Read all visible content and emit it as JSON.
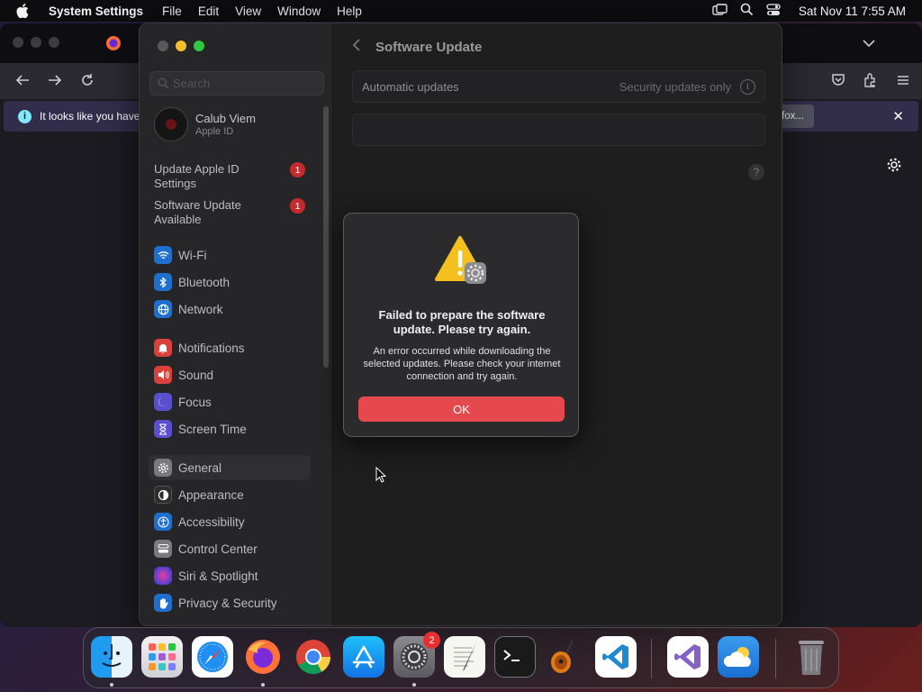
{
  "menubar": {
    "app_name": "System Settings",
    "menus": [
      "File",
      "Edit",
      "View",
      "Window",
      "Help"
    ],
    "clock": "Sat Nov 11  7:55 AM"
  },
  "firefox": {
    "notice_text": "It looks like you have",
    "notice_button": "fox..."
  },
  "settings": {
    "search_placeholder": "Search",
    "profile": {
      "name": "Calub Viem",
      "subtitle": "Apple ID"
    },
    "alerts": [
      {
        "label": "Update Apple ID Settings",
        "badge": "1"
      },
      {
        "label": "Software Update Available",
        "badge": "1"
      }
    ],
    "nav_items": [
      {
        "label": "Wi-Fi",
        "icon": "wifi-icon",
        "color": "#1f6fd1"
      },
      {
        "label": "Bluetooth",
        "icon": "bluetooth-icon",
        "color": "#1f6fd1"
      },
      {
        "label": "Network",
        "icon": "globe-icon",
        "color": "#1f6fd1"
      },
      {
        "label": "Notifications",
        "icon": "bell-icon",
        "color": "#d9413a"
      },
      {
        "label": "Sound",
        "icon": "speaker-icon",
        "color": "#d9413a"
      },
      {
        "label": "Focus",
        "icon": "moon-icon",
        "color": "#5a4fcf"
      },
      {
        "label": "Screen Time",
        "icon": "hourglass-icon",
        "color": "#5a4fcf"
      },
      {
        "label": "General",
        "icon": "gear-icon",
        "color": "#7a7a7e"
      },
      {
        "label": "Appearance",
        "icon": "appearance-icon",
        "color": "#2d2d2d"
      },
      {
        "label": "Accessibility",
        "icon": "accessibility-icon",
        "color": "#1f6fd1"
      },
      {
        "label": "Control Center",
        "icon": "control-center-icon",
        "color": "#7a7a7e"
      },
      {
        "label": "Siri & Spotlight",
        "icon": "siri-icon",
        "color": "#8a3fc7"
      },
      {
        "label": "Privacy & Security",
        "icon": "hand-icon",
        "color": "#1f6fd1"
      }
    ],
    "selected_item": "General",
    "main": {
      "title": "Software Update",
      "automatic_updates_label": "Automatic updates",
      "automatic_updates_value": "Security updates only",
      "help": "?"
    }
  },
  "dialog": {
    "title": "Failed to prepare the software update. Please try again.",
    "message": "An error occurred while downloading the selected updates. Please check your internet connection and try again.",
    "ok_label": "OK"
  },
  "dock": {
    "apps": [
      "Finder",
      "Launchpad",
      "Safari",
      "Firefox",
      "Chrome",
      "App Store",
      "System Settings",
      "TextEdit",
      "Terminal",
      "GarageBand",
      "Visual Studio Code",
      "Visual Studio",
      "Weather",
      "Trash"
    ],
    "settings_badge": "2"
  }
}
